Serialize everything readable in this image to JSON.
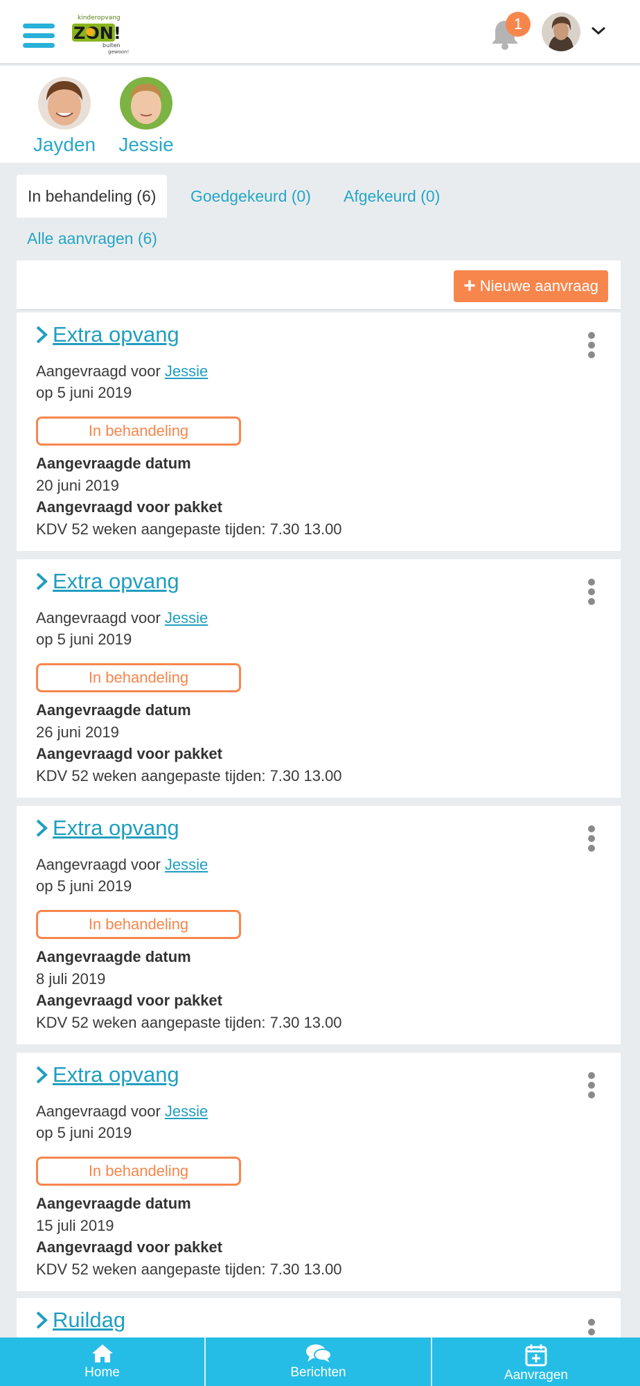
{
  "header": {
    "logo_text": [
      "kinderopvang",
      "ZON!",
      "buiten",
      "gewoon!"
    ],
    "notification_count": "1"
  },
  "children": [
    {
      "name": "Jayden"
    },
    {
      "name": "Jessie"
    }
  ],
  "tabs": [
    {
      "label": "In behandeling (6)",
      "active": true
    },
    {
      "label": "Goedgekeurd (0)"
    },
    {
      "label": "Afgekeurd (0)"
    },
    {
      "label": "Alle aanvragen (6)"
    }
  ],
  "toolbar": {
    "new_request_label": "Nieuwe aanvraag"
  },
  "requests": [
    {
      "title": "Extra opvang",
      "requested_for_prefix": "Aangevraagd voor ",
      "child": "Jessie",
      "request_date": "op 5 juni 2019",
      "status": "In behandeling",
      "date_label": "Aangevraagde datum",
      "date_value": "20 juni 2019",
      "package_label": "Aangevraagd voor pakket",
      "package_value": "KDV 52 weken aangepaste tijden: 7.30 13.00"
    },
    {
      "title": "Extra opvang",
      "requested_for_prefix": "Aangevraagd voor ",
      "child": "Jessie",
      "request_date": "op 5 juni 2019",
      "status": "In behandeling",
      "date_label": "Aangevraagde datum",
      "date_value": "26 juni 2019",
      "package_label": "Aangevraagd voor pakket",
      "package_value": "KDV 52 weken aangepaste tijden: 7.30 13.00"
    },
    {
      "title": "Extra opvang",
      "requested_for_prefix": "Aangevraagd voor ",
      "child": "Jessie",
      "request_date": "op 5 juni 2019",
      "status": "In behandeling",
      "date_label": "Aangevraagde datum",
      "date_value": "8 juli 2019",
      "package_label": "Aangevraagd voor pakket",
      "package_value": "KDV 52 weken aangepaste tijden: 7.30 13.00"
    },
    {
      "title": "Extra opvang",
      "requested_for_prefix": "Aangevraagd voor ",
      "child": "Jessie",
      "request_date": "op 5 juni 2019",
      "status": "In behandeling",
      "date_label": "Aangevraagde datum",
      "date_value": "15 juli 2019",
      "package_label": "Aangevraagd voor pakket",
      "package_value": "KDV 52 weken aangepaste tijden: 7.30 13.00"
    }
  ],
  "partial_request": {
    "title": "Ruildag"
  },
  "bottom_nav": [
    {
      "label": "Home",
      "icon": "home-icon"
    },
    {
      "label": "Berichten",
      "icon": "chat-icon"
    },
    {
      "label": "Aanvragen",
      "icon": "calendar-plus-icon"
    }
  ],
  "colors": {
    "accent": "#25bde6",
    "link": "#1f9ec0",
    "orange": "#f7864c",
    "background": "#e9ecef"
  }
}
